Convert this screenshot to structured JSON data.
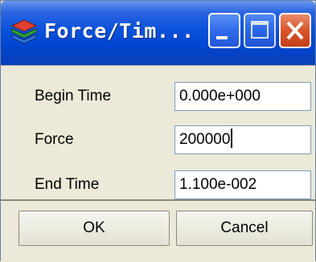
{
  "window": {
    "title": "Force/Tim...",
    "app_icon": "layers-icon",
    "controls": {
      "minimize": "minimize-icon",
      "maximize": "maximize-icon",
      "close": "close-icon"
    }
  },
  "form": {
    "begin_time": {
      "label": "Begin Time",
      "value": "0.000e+000"
    },
    "force": {
      "label": "Force",
      "value": "200000"
    },
    "end_time": {
      "label": "End Time",
      "value": "1.100e-002"
    }
  },
  "buttons": {
    "ok": "OK",
    "cancel": "Cancel"
  },
  "colors": {
    "titlebar": "#0a52db",
    "dialog_bg": "#ece9d8",
    "close_button": "#d9552b",
    "field_border": "#7f9db9"
  }
}
